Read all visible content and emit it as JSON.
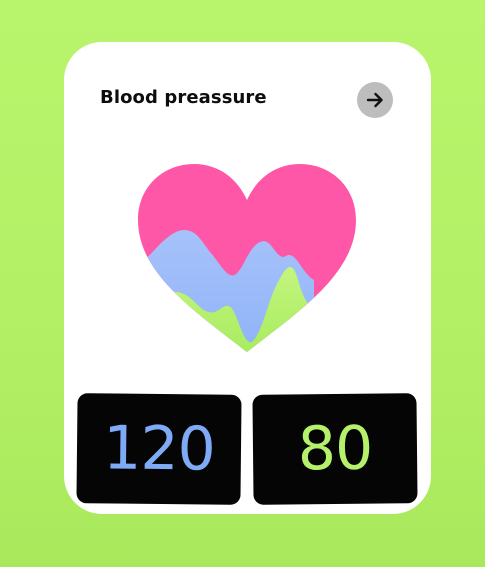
{
  "card": {
    "title": "Blood preassure"
  },
  "readings": {
    "systolic": "120",
    "diastolic": "80"
  },
  "icons": {
    "next": "arrow-right-icon",
    "illustration": "heart-wave-icon"
  },
  "colors": {
    "background": "#b8f56c",
    "heart": "#ff57a8",
    "wave_blue": "#9dbcfa",
    "wave_green": "#b6f16c",
    "systolic_text": "#7eaaf6",
    "diastolic_text": "#b6f16c",
    "tile": "#050505"
  }
}
